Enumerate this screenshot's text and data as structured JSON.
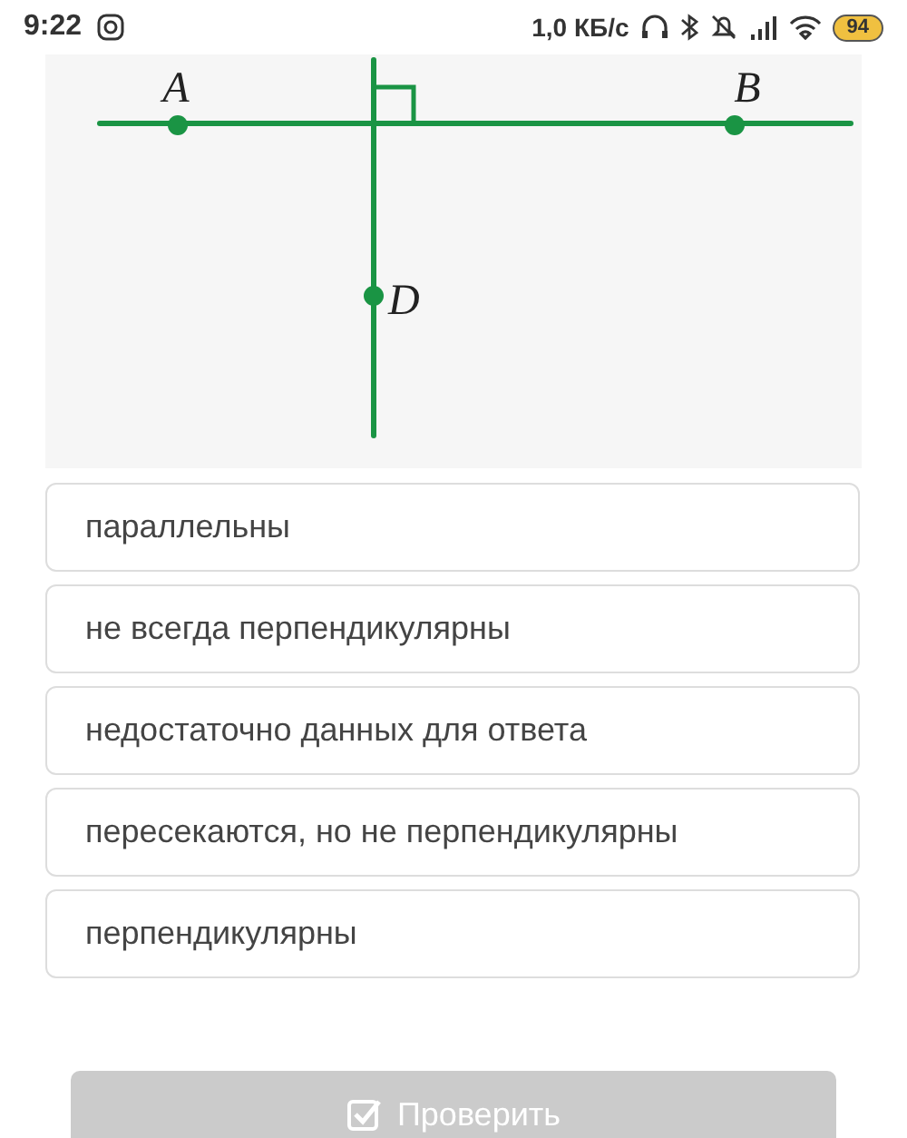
{
  "status_bar": {
    "time": "9:22",
    "speed": "1,0 КБ/с",
    "battery": "94"
  },
  "diagram": {
    "points": [
      {
        "label": "A"
      },
      {
        "label": "B"
      },
      {
        "label": "D"
      }
    ]
  },
  "options": [
    {
      "text": "параллельны"
    },
    {
      "text": "не всегда перпендикулярны"
    },
    {
      "text": "недостаточно данных для ответа"
    },
    {
      "text": "пересекаются, но не перпендикулярны"
    },
    {
      "text": "перпендикулярны"
    }
  ],
  "check_button": {
    "label": "Проверить",
    "disabled": true
  }
}
